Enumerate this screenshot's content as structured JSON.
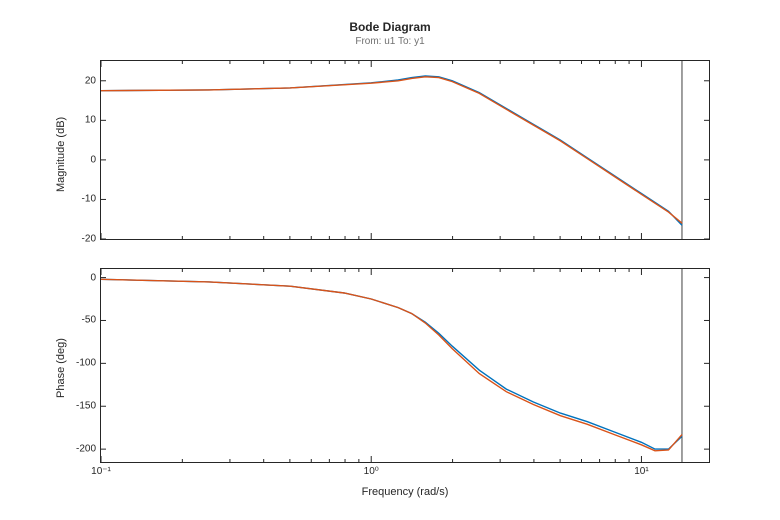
{
  "title": "Bode Diagram",
  "subtitle": "From: u1  To: y1",
  "xlabel": "Frequency (rad/s)",
  "mag": {
    "ylabel": "Magnitude (dB)",
    "ylim": [
      -20,
      25
    ],
    "yticks": [
      -20,
      -10,
      0,
      10,
      20
    ]
  },
  "phase": {
    "ylabel": "Phase (deg)",
    "ylim": [
      -215,
      10
    ],
    "yticks": [
      -200,
      -150,
      -100,
      -50,
      0
    ]
  },
  "xlim_log10": [
    -1,
    1.25
  ],
  "xticks_log10": [
    -1,
    0,
    1
  ],
  "xtick_labels": [
    "10⁻¹",
    "10⁰",
    "10¹"
  ],
  "nyquist_line_log10": 1.15,
  "chart_data": [
    {
      "type": "line",
      "title": "Magnitude (dB)",
      "xlabel": "Frequency (rad/s)",
      "ylabel": "Magnitude (dB)",
      "ylim": [
        -20,
        25
      ],
      "x_log10": [
        -1.0,
        -0.6,
        -0.3,
        0.0,
        0.1,
        0.15,
        0.2,
        0.25,
        0.3,
        0.4,
        0.5,
        0.6,
        0.7,
        0.8,
        0.9,
        1.0,
        1.1,
        1.15
      ],
      "series": [
        {
          "name": "blue",
          "color": "#0072BD",
          "values": [
            17.5,
            17.7,
            18.2,
            19.5,
            20.2,
            20.8,
            21.2,
            21.0,
            20.0,
            17.0,
            13.0,
            9.0,
            5.0,
            0.5,
            -4.0,
            -8.5,
            -13.0,
            -16.5
          ]
        },
        {
          "name": "orange",
          "color": "#D95319",
          "values": [
            17.5,
            17.7,
            18.2,
            19.4,
            20.0,
            20.6,
            21.0,
            20.8,
            19.8,
            16.8,
            12.8,
            8.8,
            4.8,
            0.3,
            -4.2,
            -8.7,
            -13.2,
            -16.0
          ]
        }
      ]
    },
    {
      "type": "line",
      "title": "Phase (deg)",
      "xlabel": "Frequency (rad/s)",
      "ylabel": "Phase (deg)",
      "ylim": [
        -215,
        10
      ],
      "x_log10": [
        -1.0,
        -0.6,
        -0.3,
        -0.1,
        0.0,
        0.1,
        0.15,
        0.2,
        0.25,
        0.3,
        0.4,
        0.5,
        0.6,
        0.7,
        0.8,
        0.9,
        1.0,
        1.05,
        1.1,
        1.15
      ],
      "series": [
        {
          "name": "blue",
          "color": "#0072BD",
          "values": [
            -2,
            -5,
            -10,
            -18,
            -25,
            -35,
            -42,
            -52,
            -65,
            -80,
            -108,
            -130,
            -145,
            -158,
            -168,
            -180,
            -192,
            -200,
            -200,
            -185
          ]
        },
        {
          "name": "orange",
          "color": "#D95319",
          "values": [
            -2,
            -5,
            -10,
            -18,
            -25,
            -35,
            -42,
            -53,
            -67,
            -83,
            -112,
            -133,
            -148,
            -161,
            -171,
            -183,
            -195,
            -202,
            -201,
            -183
          ]
        }
      ]
    }
  ]
}
